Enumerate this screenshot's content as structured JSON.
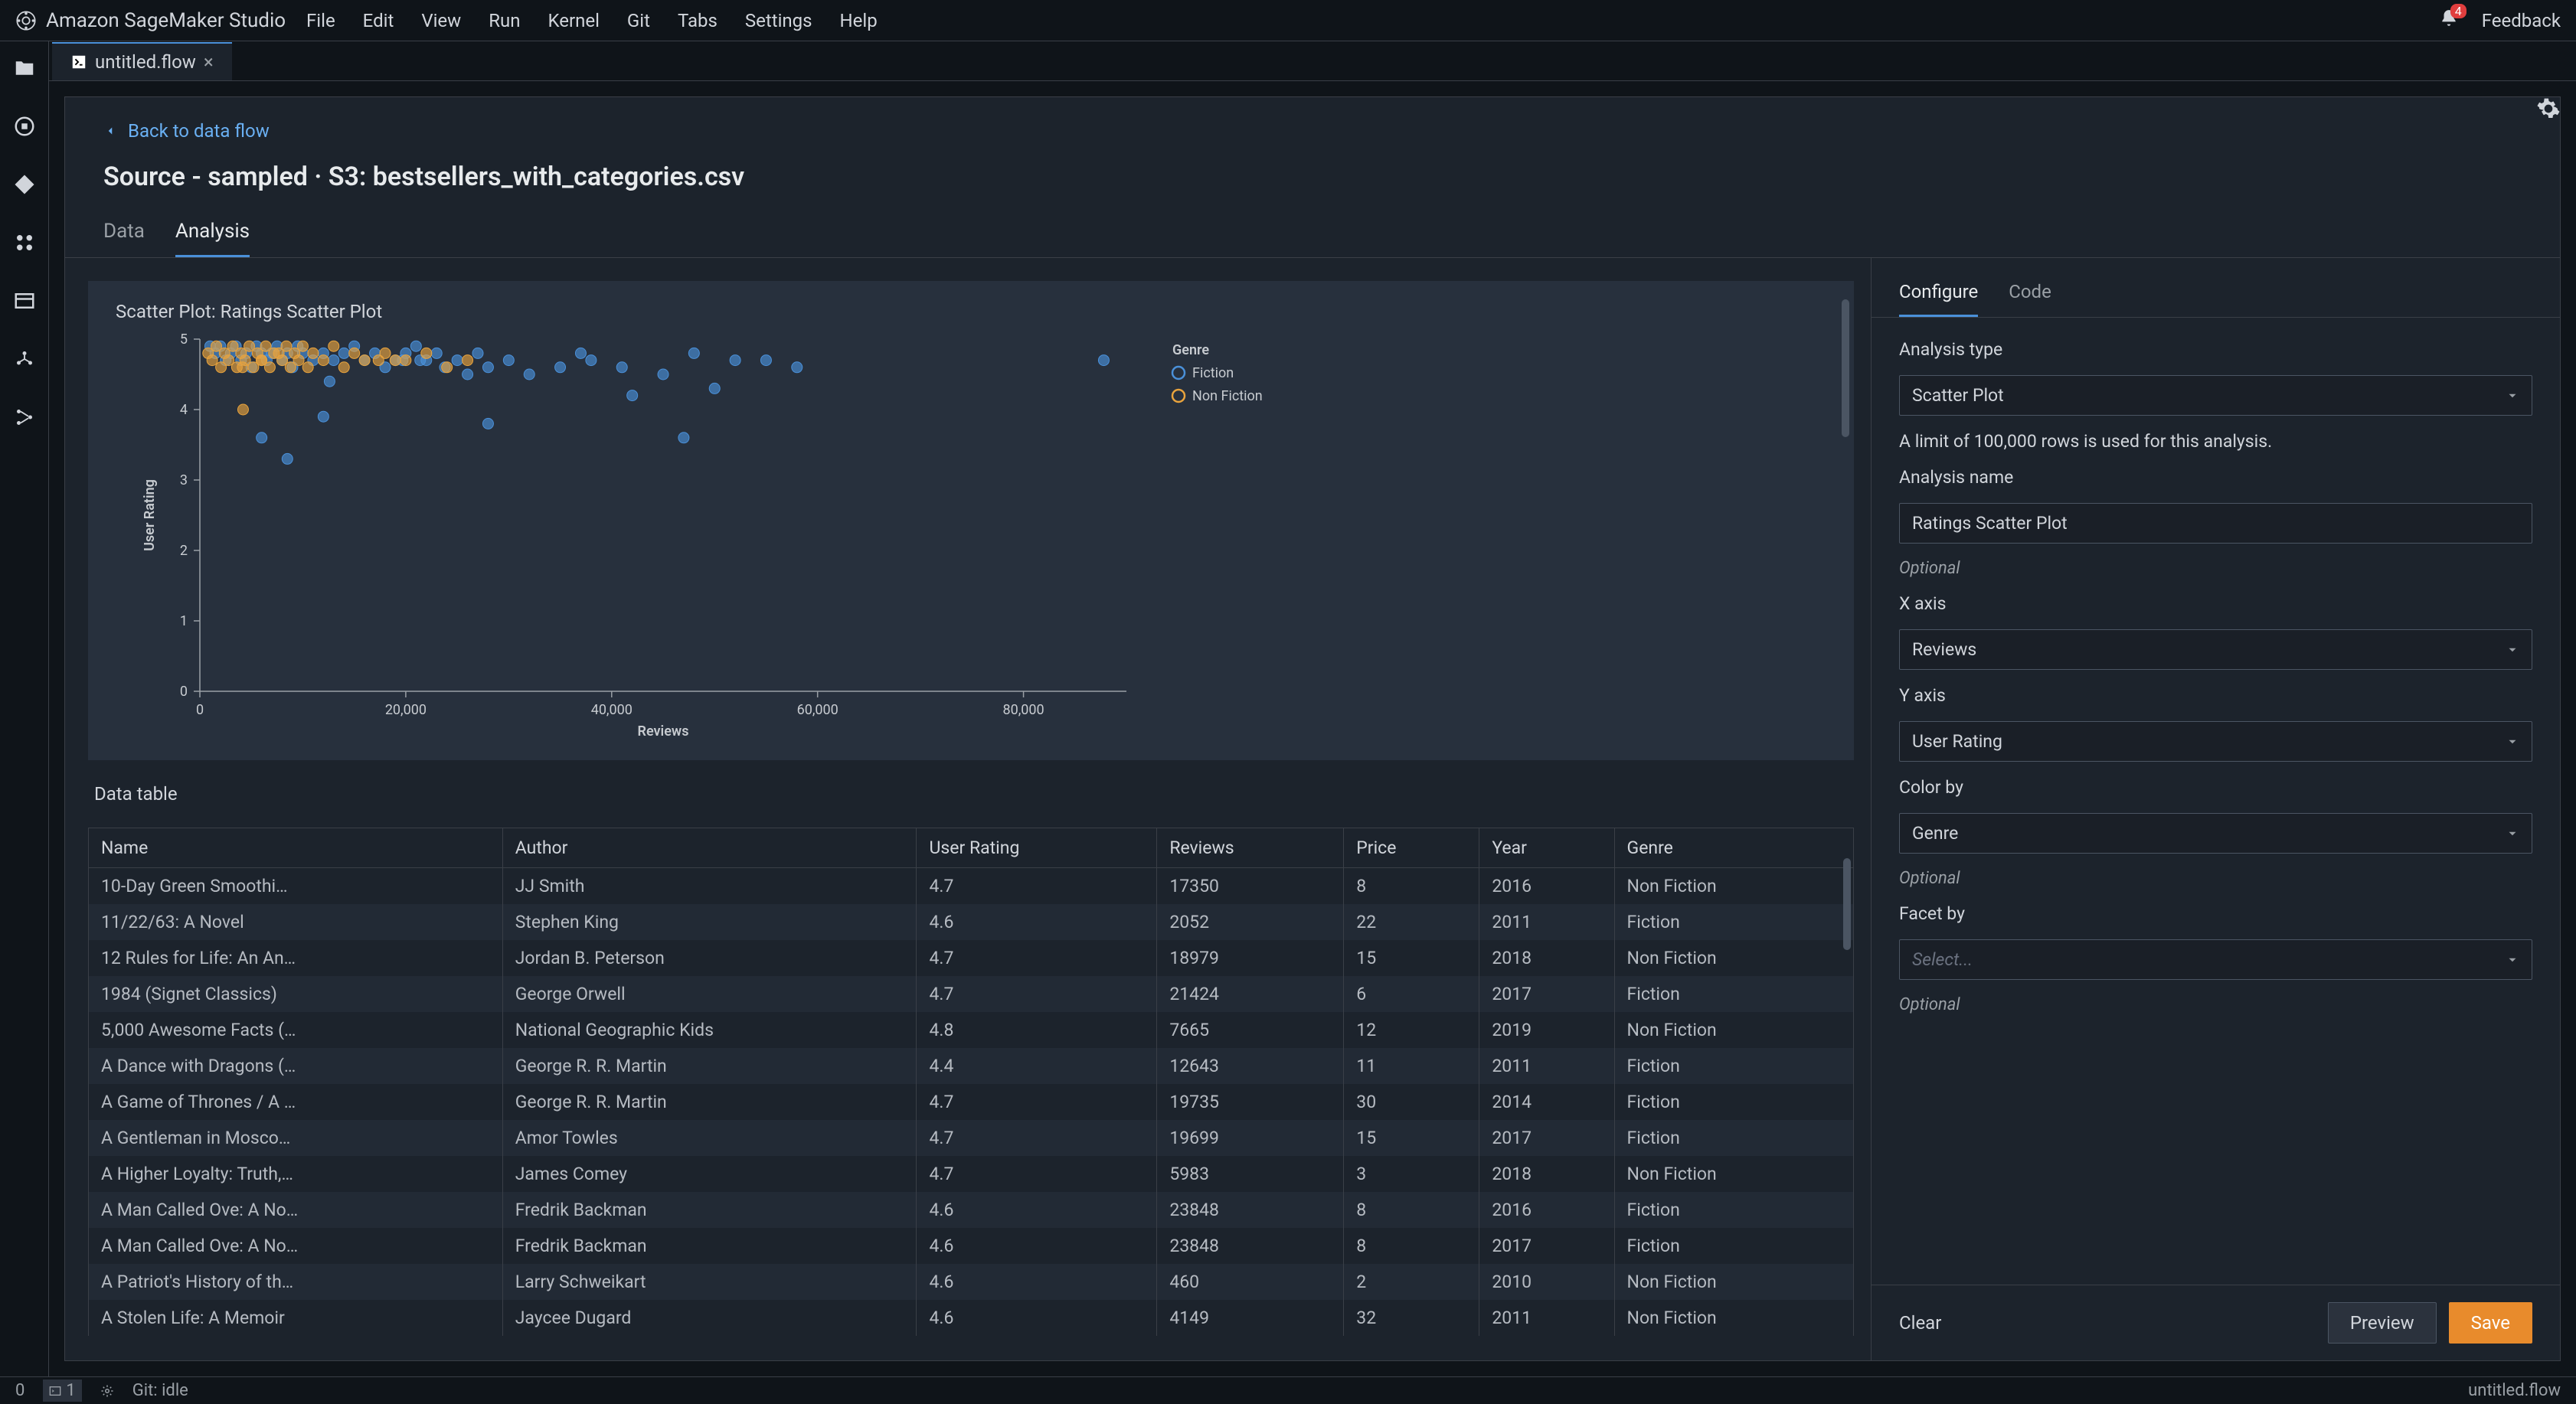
{
  "menubar": {
    "product": "Amazon SageMaker Studio",
    "menus": [
      "File",
      "Edit",
      "View",
      "Run",
      "Kernel",
      "Git",
      "Tabs",
      "Settings",
      "Help"
    ],
    "notif_count": "4",
    "feedback": "Feedback"
  },
  "tab": {
    "label": "untitled.flow"
  },
  "breadcrumb": "Back to data flow",
  "page_title": "Source - sampled · S3: bestsellers_with_categories.csv",
  "local_tabs": {
    "data": "Data",
    "analysis": "Analysis"
  },
  "chart_data": {
    "type": "scatter",
    "title": "Scatter Plot: Ratings Scatter Plot",
    "xlabel": "Reviews",
    "ylabel": "User Rating",
    "xlim": [
      0,
      90000
    ],
    "ylim": [
      0,
      5
    ],
    "x_ticks": [
      0,
      20000,
      40000,
      60000,
      80000
    ],
    "x_tick_labels": [
      "0",
      "20,000",
      "40,000",
      "60,000",
      "80,000"
    ],
    "y_ticks": [
      0,
      1,
      2,
      3,
      4,
      5
    ],
    "legend_title": "Genre",
    "series": [
      {
        "name": "Fiction",
        "color": "#4a90d9",
        "points": [
          [
            1000,
            4.9
          ],
          [
            1500,
            4.8
          ],
          [
            2000,
            4.9
          ],
          [
            2500,
            4.7
          ],
          [
            3000,
            4.8
          ],
          [
            3500,
            4.9
          ],
          [
            4000,
            4.7
          ],
          [
            4500,
            4.8
          ],
          [
            5000,
            4.6
          ],
          [
            5500,
            4.9
          ],
          [
            6000,
            4.8
          ],
          [
            6500,
            4.7
          ],
          [
            7000,
            4.8
          ],
          [
            7500,
            4.9
          ],
          [
            8000,
            4.7
          ],
          [
            8500,
            4.8
          ],
          [
            9000,
            4.6
          ],
          [
            9500,
            4.9
          ],
          [
            10000,
            4.8
          ],
          [
            11000,
            4.7
          ],
          [
            12000,
            4.8
          ],
          [
            12600,
            4.4
          ],
          [
            13000,
            4.7
          ],
          [
            14000,
            4.8
          ],
          [
            15000,
            4.9
          ],
          [
            16000,
            4.7
          ],
          [
            17000,
            4.8
          ],
          [
            18000,
            4.6
          ],
          [
            19000,
            4.7
          ],
          [
            19700,
            4.7
          ],
          [
            20000,
            4.8
          ],
          [
            21000,
            4.9
          ],
          [
            21400,
            4.7
          ],
          [
            22000,
            4.7
          ],
          [
            23000,
            4.8
          ],
          [
            23800,
            4.6
          ],
          [
            25000,
            4.7
          ],
          [
            26000,
            4.5
          ],
          [
            27000,
            4.8
          ],
          [
            28000,
            4.6
          ],
          [
            30000,
            4.7
          ],
          [
            32000,
            4.5
          ],
          [
            35000,
            4.6
          ],
          [
            37000,
            4.8
          ],
          [
            38000,
            4.7
          ],
          [
            41000,
            4.6
          ],
          [
            42000,
            4.2
          ],
          [
            45000,
            4.5
          ],
          [
            48000,
            4.8
          ],
          [
            50000,
            4.3
          ],
          [
            52000,
            4.7
          ],
          [
            55000,
            4.7
          ],
          [
            58000,
            4.6
          ],
          [
            47000,
            3.6
          ],
          [
            28000,
            3.8
          ],
          [
            8500,
            3.3
          ],
          [
            6000,
            3.6
          ],
          [
            12000,
            3.9
          ],
          [
            87800,
            4.7
          ]
        ]
      },
      {
        "name": "Non Fiction",
        "color": "#e8a33d",
        "points": [
          [
            800,
            4.8
          ],
          [
            1200,
            4.7
          ],
          [
            1600,
            4.9
          ],
          [
            2052,
            4.6
          ],
          [
            2400,
            4.8
          ],
          [
            2800,
            4.7
          ],
          [
            3200,
            4.9
          ],
          [
            3600,
            4.6
          ],
          [
            4000,
            4.8
          ],
          [
            4400,
            4.7
          ],
          [
            4800,
            4.9
          ],
          [
            5200,
            4.6
          ],
          [
            5600,
            4.8
          ],
          [
            6000,
            4.7
          ],
          [
            6400,
            4.9
          ],
          [
            6800,
            4.6
          ],
          [
            7200,
            4.8
          ],
          [
            7665,
            4.8
          ],
          [
            8000,
            4.7
          ],
          [
            8400,
            4.9
          ],
          [
            8800,
            4.6
          ],
          [
            9200,
            4.8
          ],
          [
            9600,
            4.7
          ],
          [
            10000,
            4.9
          ],
          [
            10500,
            4.6
          ],
          [
            11000,
            4.8
          ],
          [
            12000,
            4.7
          ],
          [
            13000,
            4.9
          ],
          [
            14000,
            4.6
          ],
          [
            15000,
            4.8
          ],
          [
            16000,
            4.7
          ],
          [
            17350,
            4.7
          ],
          [
            18000,
            4.8
          ],
          [
            18979,
            4.7
          ],
          [
            20000,
            4.7
          ],
          [
            22000,
            4.8
          ],
          [
            24000,
            4.6
          ],
          [
            26000,
            4.7
          ],
          [
            4200,
            4.0
          ],
          [
            4149,
            4.6
          ],
          [
            5983,
            4.7
          ]
        ]
      }
    ]
  },
  "table": {
    "title": "Data table",
    "columns": [
      "Name",
      "Author",
      "User Rating",
      "Reviews",
      "Price",
      "Year",
      "Genre"
    ],
    "rows": [
      [
        "10-Day Green Smoothi…",
        "JJ Smith",
        "4.7",
        "17350",
        "8",
        "2016",
        "Non Fiction"
      ],
      [
        "11/22/63: A Novel",
        "Stephen King",
        "4.6",
        "2052",
        "22",
        "2011",
        "Fiction"
      ],
      [
        "12 Rules for Life: An An…",
        "Jordan B. Peterson",
        "4.7",
        "18979",
        "15",
        "2018",
        "Non Fiction"
      ],
      [
        "1984 (Signet Classics)",
        "George Orwell",
        "4.7",
        "21424",
        "6",
        "2017",
        "Fiction"
      ],
      [
        "5,000 Awesome Facts (…",
        "National Geographic Kids",
        "4.8",
        "7665",
        "12",
        "2019",
        "Non Fiction"
      ],
      [
        "A Dance with Dragons (…",
        "George R. R. Martin",
        "4.4",
        "12643",
        "11",
        "2011",
        "Fiction"
      ],
      [
        "A Game of Thrones / A …",
        "George R. R. Martin",
        "4.7",
        "19735",
        "30",
        "2014",
        "Fiction"
      ],
      [
        "A Gentleman in Mosco…",
        "Amor Towles",
        "4.7",
        "19699",
        "15",
        "2017",
        "Fiction"
      ],
      [
        "A Higher Loyalty: Truth,…",
        "James Comey",
        "4.7",
        "5983",
        "3",
        "2018",
        "Non Fiction"
      ],
      [
        "A Man Called Ove: A No…",
        "Fredrik Backman",
        "4.6",
        "23848",
        "8",
        "2016",
        "Fiction"
      ],
      [
        "A Man Called Ove: A No…",
        "Fredrik Backman",
        "4.6",
        "23848",
        "8",
        "2017",
        "Fiction"
      ],
      [
        "A Patriot's History of th…",
        "Larry Schweikart",
        "4.6",
        "460",
        "2",
        "2010",
        "Non Fiction"
      ],
      [
        "A Stolen Life: A Memoir",
        "Jaycee Dugard",
        "4.6",
        "4149",
        "32",
        "2011",
        "Non Fiction"
      ]
    ]
  },
  "configure": {
    "tabs": {
      "configure": "Configure",
      "code": "Code"
    },
    "analysis_type_label": "Analysis type",
    "analysis_type_value": "Scatter Plot",
    "limit_note": "A limit of 100,000 rows is used for this analysis.",
    "analysis_name_label": "Analysis name",
    "analysis_name_value": "Ratings Scatter Plot",
    "optional": "Optional",
    "x_axis_label": "X axis",
    "x_axis_value": "Reviews",
    "y_axis_label": "Y axis",
    "y_axis_value": "User Rating",
    "color_by_label": "Color by",
    "color_by_value": "Genre",
    "facet_by_label": "Facet by",
    "facet_by_placeholder": "Select...",
    "clear": "Clear",
    "preview": "Preview",
    "save": "Save"
  },
  "statusbar": {
    "left0": "0",
    "terminal": "1",
    "git": "Git: idle",
    "right": "untitled.flow"
  }
}
